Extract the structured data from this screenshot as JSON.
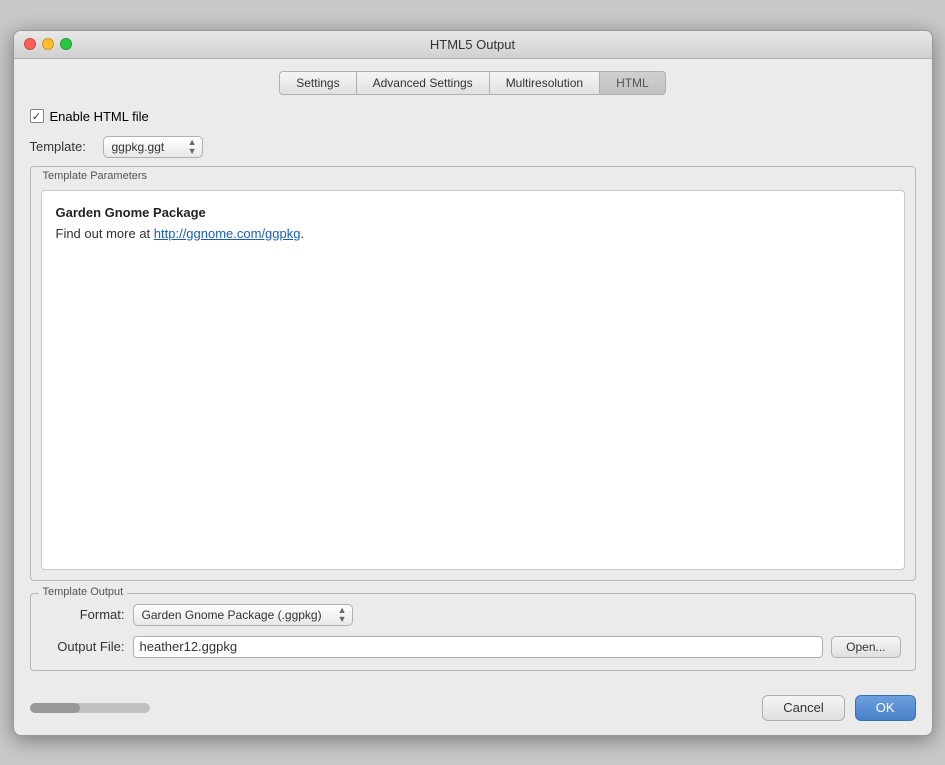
{
  "window": {
    "title": "HTML5 Output"
  },
  "tabs": [
    {
      "id": "settings",
      "label": "Settings",
      "active": false
    },
    {
      "id": "advanced-settings",
      "label": "Advanced Settings",
      "active": false
    },
    {
      "id": "multiresolution",
      "label": "Multiresolution",
      "active": false
    },
    {
      "id": "html",
      "label": "HTML",
      "active": true
    }
  ],
  "enable_checkbox": {
    "checked": true,
    "label": "Enable HTML file"
  },
  "template": {
    "label": "Template:",
    "value": "ggpkg.ggt"
  },
  "template_parameters": {
    "legend": "Template Parameters",
    "heading": "Garden Gnome Package",
    "description_text": "Find out more at ",
    "link_text": "http://ggnome.com/ggpkg",
    "link_url": "http://ggnome.com/ggpkg",
    "description_suffix": "."
  },
  "template_output": {
    "legend": "Template Output",
    "format_label": "Format:",
    "format_value": "Garden Gnome Package (.ggpkg)",
    "output_file_label": "Output File:",
    "output_file_value": "heather12.ggpkg",
    "open_button_label": "Open..."
  },
  "buttons": {
    "cancel": "Cancel",
    "ok": "OK"
  }
}
